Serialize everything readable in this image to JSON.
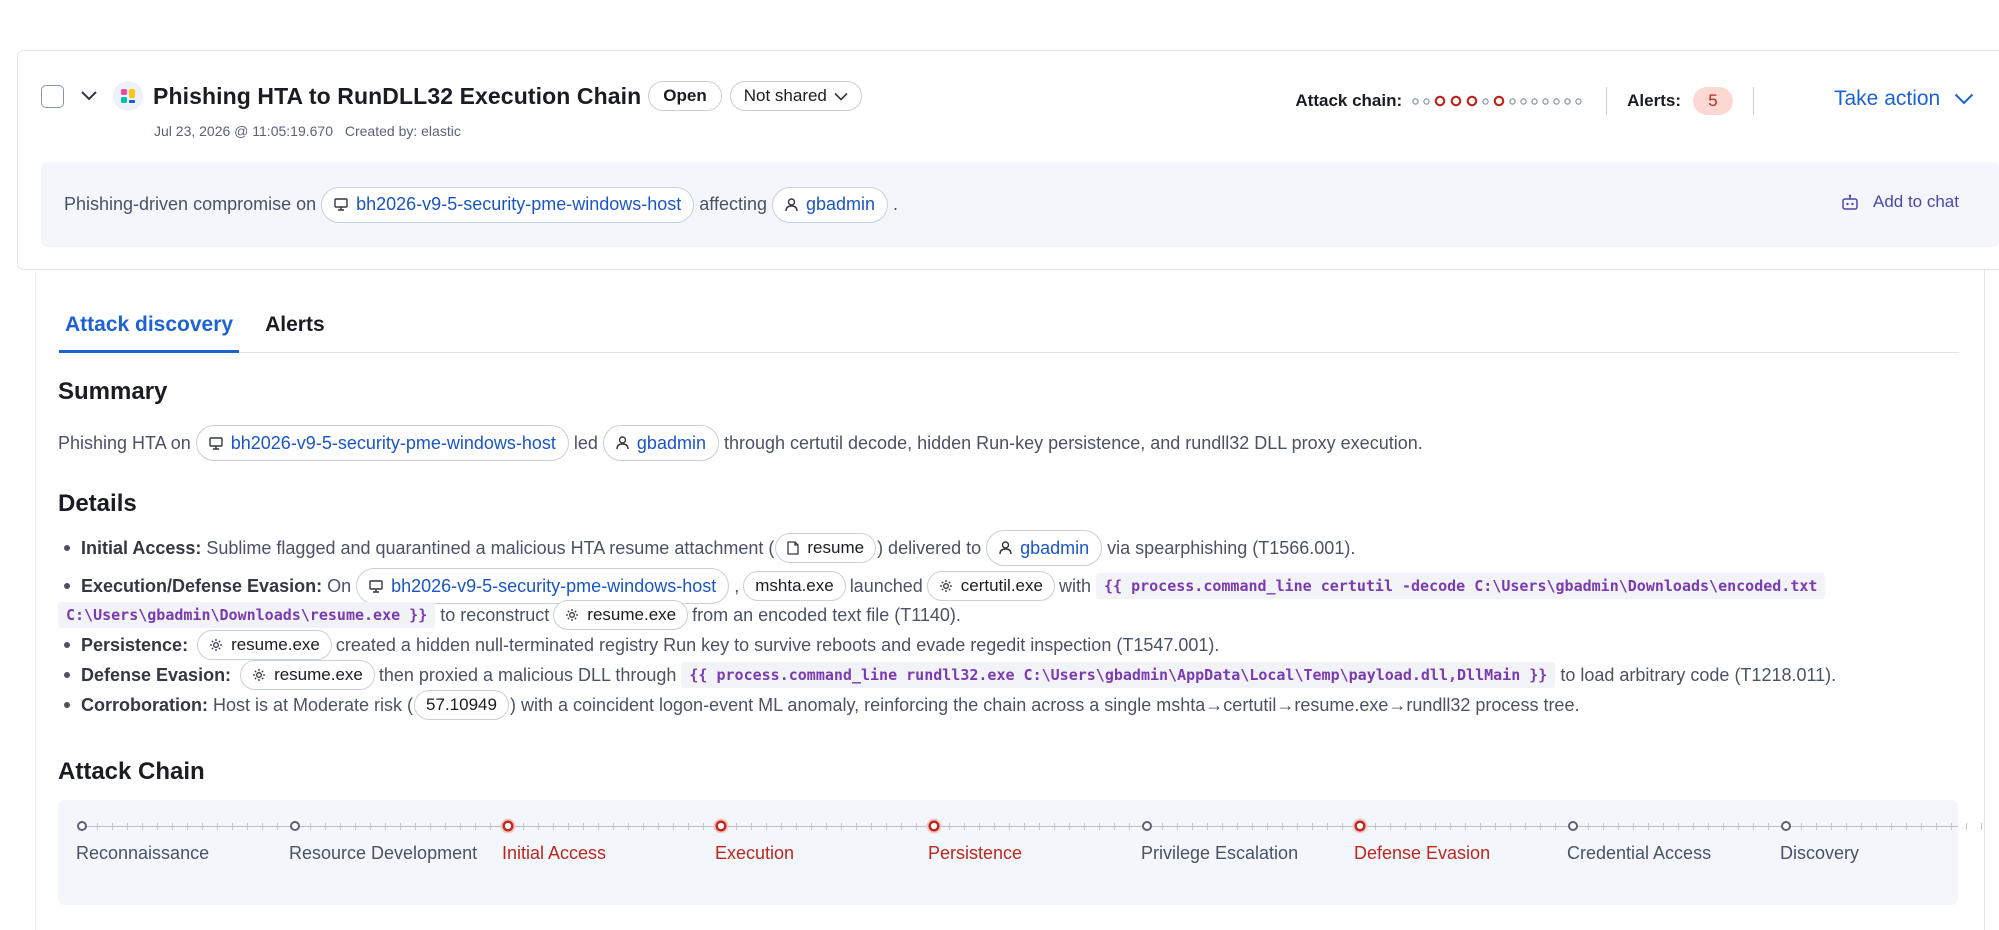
{
  "header": {
    "title": "Phishing HTA to RunDLL32 Execution Chain",
    "status": "Open",
    "sharing": "Not shared",
    "timestamp": "Jul 23, 2026 @ 11:05:19.670",
    "created_by": "Created by: elastic",
    "attack_chain_label": "Attack chain:",
    "alerts_label": "Alerts:",
    "alerts_count": "5",
    "take_action": "Take action"
  },
  "summary_bar": {
    "prefix": "Phishing-driven compromise on",
    "host": "bh2026-v9-5-security-pme-windows-host",
    "middle": "affecting",
    "user": "gbadmin",
    "suffix": ".",
    "add_to_chat": "Add to chat"
  },
  "tabs": [
    "Attack discovery",
    "Alerts"
  ],
  "summary": {
    "heading": "Summary",
    "prefix": "Phishing HTA on",
    "host": "bh2026-v9-5-security-pme-windows-host",
    "middle": "led",
    "user": "gbadmin",
    "suffix": "through certutil decode, hidden Run-key persistence, and rundll32 DLL proxy execution."
  },
  "details": {
    "heading": "Details",
    "initial_access": {
      "label": "Initial Access:",
      "t1": "Sublime flagged and quarantined a malicious HTA resume attachment (",
      "file": "resume",
      "t2": ") delivered to",
      "user": "gbadmin",
      "t3": "via spearphishing (T1566.001)."
    },
    "execution": {
      "label": "Execution/Defense Evasion:",
      "t1": "On",
      "host": "bh2026-v9-5-security-pme-windows-host",
      "comma": ",",
      "proc1": "mshta.exe",
      "t2": "launched",
      "proc2": "certutil.exe",
      "t3": "with",
      "code1": "{{ process.command_line certutil -decode C:\\Users\\gbadmin\\Downloads\\encoded.txt",
      "code2": "C:\\Users\\gbadmin\\Downloads\\resume.exe }}",
      "t4": "to reconstruct",
      "proc3": "resume.exe",
      "t5": "from an encoded text file (T1140)."
    },
    "persistence": {
      "label": "Persistence:",
      "proc": "resume.exe",
      "text": "created a hidden null-terminated registry Run key to survive reboots and evade regedit inspection (T1547.001)."
    },
    "defense_evasion": {
      "label": "Defense Evasion:",
      "proc": "resume.exe",
      "t1": "then proxied a malicious DLL through",
      "code": "{{ process.command_line rundll32.exe C:\\Users\\gbadmin\\AppData\\Local\\Temp\\payload.dll,DllMain }}",
      "t2": "to load arbitrary code (T1218.011)."
    },
    "corroboration": {
      "label": "Corroboration:",
      "t1": "Host is at Moderate risk (",
      "score": "57.10949",
      "t2": ") with a coincident logon-event ML anomaly, reinforcing the chain across a single mshta→certutil→resume.exe→rundll32 process tree."
    }
  },
  "attack_chain": {
    "heading": "Attack Chain",
    "stages": [
      {
        "name": "Reconnaissance",
        "hit": false
      },
      {
        "name": "Resource Development",
        "hit": false
      },
      {
        "name": "Initial Access",
        "hit": true
      },
      {
        "name": "Execution",
        "hit": true
      },
      {
        "name": "Persistence",
        "hit": true
      },
      {
        "name": "Privilege Escalation",
        "hit": false
      },
      {
        "name": "Defense Evasion",
        "hit": true
      },
      {
        "name": "Credential Access",
        "hit": false
      },
      {
        "name": "Discovery",
        "hit": false
      }
    ],
    "mini_chain_hits": [
      false,
      false,
      true,
      true,
      true,
      false,
      true,
      false,
      false,
      false,
      false,
      false,
      false,
      false
    ]
  },
  "colors": {
    "accent": "#1d62d3",
    "danger": "#bd271e",
    "code": "#7a3ab2"
  }
}
